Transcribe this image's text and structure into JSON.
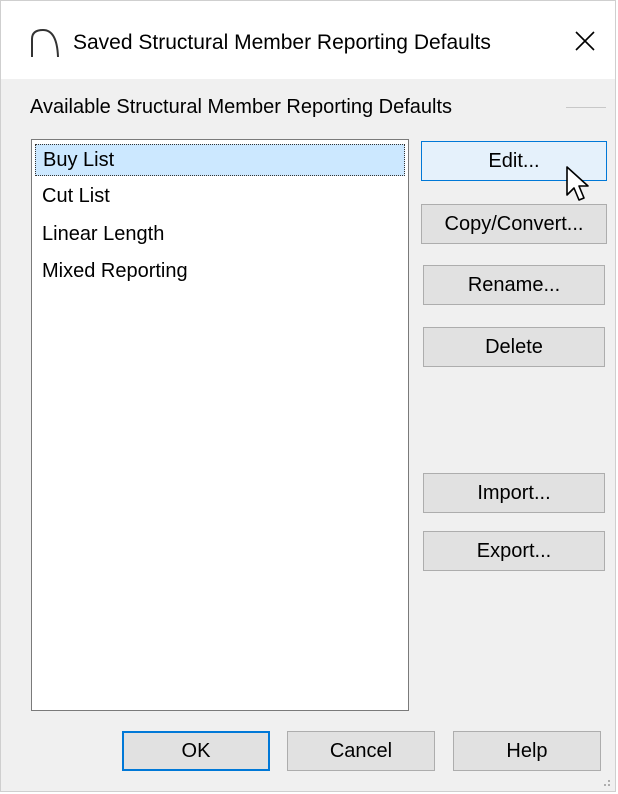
{
  "dialog": {
    "title": "Saved Structural Member Reporting Defaults",
    "app_icon": "arch-app-icon",
    "close_icon": "close-icon",
    "close_glyph": "✕"
  },
  "group": {
    "label": "Available Structural Member Reporting Defaults"
  },
  "list": {
    "items": [
      {
        "label": "Buy List",
        "selected": true
      },
      {
        "label": "Cut List",
        "selected": false
      },
      {
        "label": "Linear Length",
        "selected": false
      },
      {
        "label": "Mixed Reporting",
        "selected": false
      }
    ]
  },
  "buttons": {
    "edit": "Edit...",
    "copy_convert": "Copy/Convert...",
    "rename": "Rename...",
    "delete": "Delete",
    "import": "Import...",
    "export": "Export...",
    "ok": "OK",
    "cancel": "Cancel",
    "help": "Help"
  },
  "colors": {
    "selection": "#cce8ff",
    "accent": "#0078d7",
    "dialog_bg": "#f0f0f0"
  }
}
